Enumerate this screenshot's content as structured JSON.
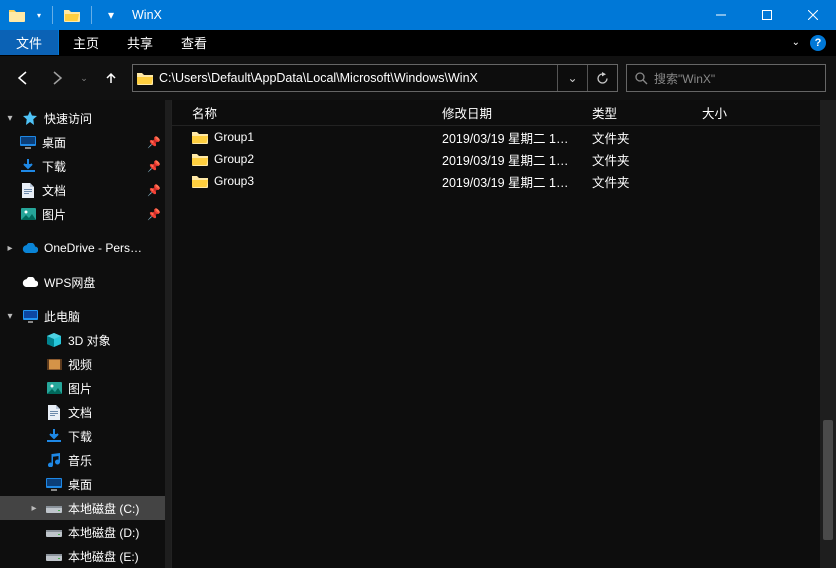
{
  "title": "WinX",
  "ribbon": {
    "file": "文件",
    "tabs": [
      "主页",
      "共享",
      "查看"
    ]
  },
  "nav": {
    "address": "C:\\Users\\Default\\AppData\\Local\\Microsoft\\Windows\\WinX",
    "search_placeholder": "搜索\"WinX\""
  },
  "tree": {
    "quick_access": "快速访问",
    "quick_items": [
      {
        "label": "桌面",
        "icon": "desktop",
        "pinned": true
      },
      {
        "label": "下载",
        "icon": "download",
        "pinned": true
      },
      {
        "label": "文档",
        "icon": "document",
        "pinned": true
      },
      {
        "label": "图片",
        "icon": "pictures",
        "pinned": true
      }
    ],
    "onedrive": "OneDrive - Pers…",
    "wps": "WPS网盘",
    "this_pc": "此电脑",
    "pc_items": [
      {
        "label": "3D 对象",
        "icon": "3d"
      },
      {
        "label": "视频",
        "icon": "video"
      },
      {
        "label": "图片",
        "icon": "pictures"
      },
      {
        "label": "文档",
        "icon": "document"
      },
      {
        "label": "下载",
        "icon": "download"
      },
      {
        "label": "音乐",
        "icon": "music"
      },
      {
        "label": "桌面",
        "icon": "desktop"
      },
      {
        "label": "本地磁盘 (C:)",
        "icon": "drive",
        "selected": true
      },
      {
        "label": "本地磁盘 (D:)",
        "icon": "drive"
      },
      {
        "label": "本地磁盘 (E:)",
        "icon": "drive"
      }
    ]
  },
  "columns": {
    "name": "名称",
    "date": "修改日期",
    "type": "类型",
    "size": "大小"
  },
  "items": [
    {
      "name": "Group1",
      "date": "2019/03/19 星期二 1…",
      "type": "文件夹",
      "size": ""
    },
    {
      "name": "Group2",
      "date": "2019/03/19 星期二 1…",
      "type": "文件夹",
      "size": ""
    },
    {
      "name": "Group3",
      "date": "2019/03/19 星期二 1…",
      "type": "文件夹",
      "size": ""
    }
  ]
}
